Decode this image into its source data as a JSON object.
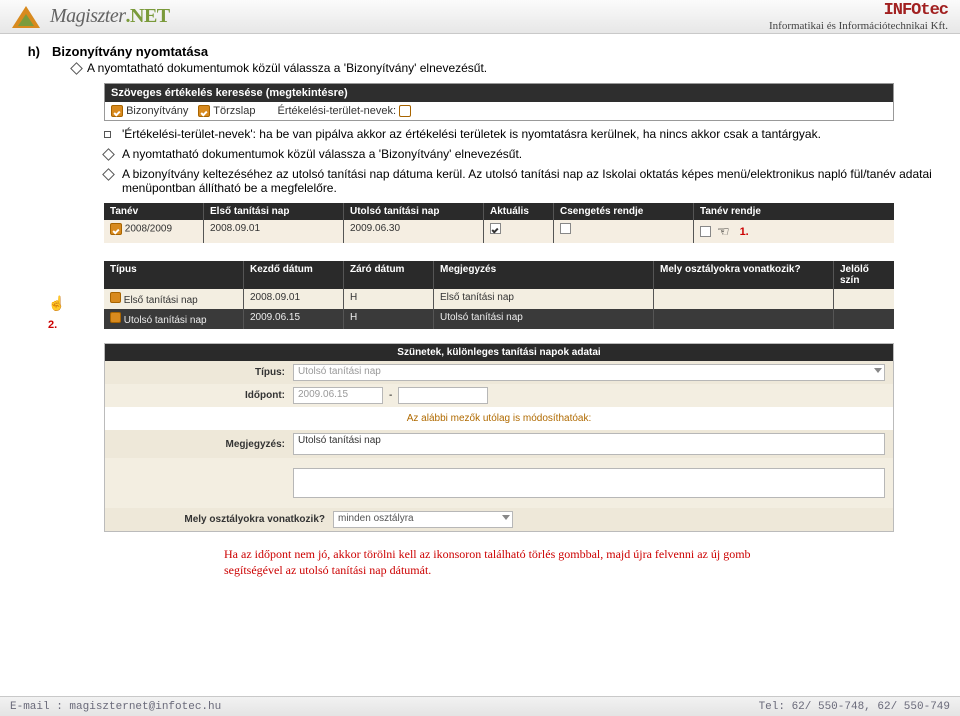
{
  "header": {
    "brand_main": "Magiszter",
    "brand_suffix": ".NET",
    "company_badge": "INFOtec",
    "company_sub": "Informatikai és Információtechnikai Kft."
  },
  "section": {
    "marker": "h)",
    "title": "Bizonyítvány nyomtatása",
    "intro": "A nyomtatható dokumentumok közül válassza a 'Bizonyítvány' elnevezésűt."
  },
  "shot1": {
    "title": "Szöveges értékelés keresése (megtekintésre)",
    "opt1": "Bizonyítvány",
    "opt2": "Törzslap",
    "lbl": "Értékelési-terület-nevek:"
  },
  "bullets": {
    "b1": "'Értékelési-terület-nevek': ha be van pipálva akkor az értékelési területek is nyomtatásra kerülnek, ha nincs akkor csak a tantárgyak.",
    "b2": "A nyomtatható dokumentumok közül válassza a 'Bizonyítvány' elnevezésűt.",
    "b3": "A bizonyítvány keltezéséhez az utolsó tanítási nap dátuma kerül. Az utolsó tanítási nap az Iskolai oktatás képes menü/elektronikus napló fül/tanév adatai menüpontban állítható be a megfelelőre."
  },
  "table_year": {
    "headers": [
      "Tanév",
      "Első tanítási nap",
      "Utolsó tanítási nap",
      "Aktuális",
      "Csengetés rendje",
      "Tanév rendje"
    ],
    "row": {
      "tanev": "2008/2009",
      "elso": "2008.09.01",
      "utolso": "2009.06.30"
    },
    "anno": "1."
  },
  "table_days": {
    "headers": [
      "Típus",
      "Kezdő dátum",
      "Záró dátum",
      "Megjegyzés",
      "Mely osztályokra vonatkozik?",
      "Jelölő szín"
    ],
    "r1": {
      "tipus": "Első tanítási nap",
      "kd": "2008.09.01",
      "zd": "H",
      "mj": "Első tanítási nap"
    },
    "r2": {
      "tipus": "Utolsó tanítási nap",
      "kd": "2009.06.15",
      "zd": "H",
      "mj": "Utolsó tanítási nap"
    },
    "anno": "2."
  },
  "form": {
    "panel_title": "Szünetek, különleges tanítási napok adatai",
    "lbl_tipus": "Típus:",
    "val_tipus": "Utolsó tanítási nap",
    "lbl_idopont": "Időpont:",
    "val_idopont": "2009.06.15",
    "sep": "-",
    "note": "Az alábbi mezők utólag is módosíthatóak:",
    "lbl_megj": "Megjegyzés:",
    "val_megj": "Utolsó tanítási nap",
    "lbl_mely": "Mely osztályokra vonatkozik?",
    "val_mely": "minden osztályra"
  },
  "rednote": "Ha az időpont nem jó, akkor törölni kell az ikonsoron található törlés gombbal, majd újra felvenni az új gomb segítségével az utolsó tanítási nap dátumát.",
  "footer": {
    "email": "E-mail : magiszternet@infotec.hu",
    "tel": "Tel: 62/ 550-748, 62/ 550-749"
  }
}
